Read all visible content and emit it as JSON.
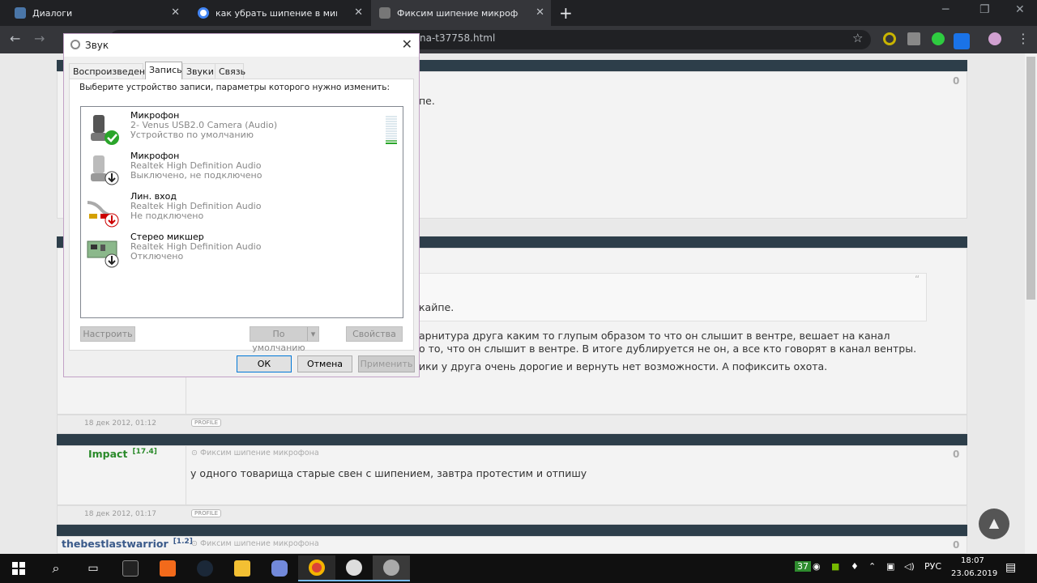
{
  "browser": {
    "tabs": [
      {
        "title": "Диалоги",
        "icon_color": "#4a76a8"
      },
      {
        "title": "как убрать шипение в микрофо",
        "icon_color": "#4285f4"
      },
      {
        "title": "Фиксим шипение микрофона :",
        "icon_color": "#888888"
      }
    ],
    "url": "na-t37758.html",
    "new_tab_label": "+"
  },
  "dialog": {
    "title": "Звук",
    "close": "✕",
    "tabs": [
      "Воспроизведение",
      "Запись",
      "Звуки",
      "Связь"
    ],
    "active_tab": "Запись",
    "instruction": "Выберите устройство записи, параметры которого нужно изменить:",
    "devices": [
      {
        "name": "Микрофон",
        "driver": "2- Venus USB2.0 Camera (Audio)",
        "status": "Устройство по умолчанию",
        "icon": "microphone-icon",
        "badge": "check-badge-icon"
      },
      {
        "name": "Микрофон",
        "driver": "Realtek High Definition Audio",
        "status": "Выключено, не подключено",
        "icon": "microphone-icon",
        "badge": "down-arrow-badge-icon"
      },
      {
        "name": "Лин. вход",
        "driver": "Realtek High Definition Audio",
        "status": "Не подключено",
        "icon": "line-in-cable-icon",
        "badge": "red-down-arrow-badge-icon"
      },
      {
        "name": "Стерео микшер",
        "driver": "Realtek High Definition Audio",
        "status": "Отключено",
        "icon": "sound-card-icon",
        "badge": "down-arrow-badge-icon"
      }
    ],
    "buttons": {
      "configure": "Настроить",
      "default": "По умолчанию",
      "properties": "Свойства",
      "ok": "ОК",
      "cancel": "Отмена",
      "apply": "Применить"
    }
  },
  "page": {
    "frag1": "пе.",
    "frag2": "кайпе.",
    "line1": "арнитура друга каким то глупым образом то что он слышит в вентре, вешает на канал",
    "line2": "о то, что он слышит в вентре. В итоге дублируется не он, а все кто говорят в канал вентры.",
    "line3": "ики у друга очень дорогие и вернуть нет возможности. А пофиксить охота.",
    "posts": [
      {
        "date": "18 дек 2012, 01:12",
        "profile": "PROFILE"
      },
      {
        "user": "Impact",
        "rep": "[17.4]",
        "topic": "Фиксим шипение микрофона",
        "text": "у одного товарища старые свен с шипением, завтра протестим и отпишу",
        "date": "18 дек 2012, 01:17",
        "profile": "PROFILE"
      },
      {
        "user": "thebestlastwarrior",
        "rep": "[1.2]",
        "topic": "Фиксим шипение микрофона"
      }
    ],
    "zero": "0"
  },
  "taskbar": {
    "lang": "РУС",
    "time": "18:07",
    "date": "23.06.2019",
    "badge": "37"
  }
}
